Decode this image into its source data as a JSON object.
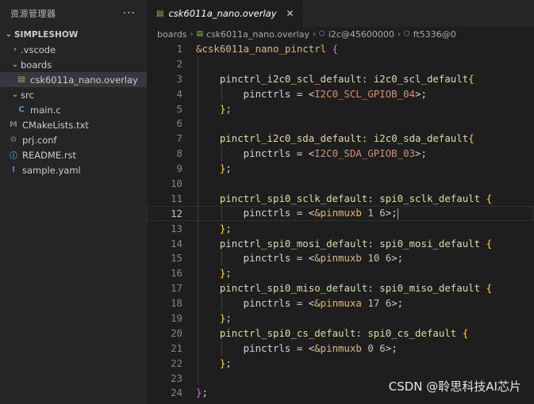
{
  "sidebar": {
    "header_label": "资源管理器",
    "more_label": "···",
    "project": "SIMPLESHOW",
    "items": [
      {
        "label": ".vscode",
        "type": "folder",
        "expanded": false
      },
      {
        "label": "boards",
        "type": "folder",
        "expanded": true
      },
      {
        "label": "csk6011a_nano.overlay",
        "type": "file",
        "icon": "devicetree-file-icon",
        "selected": true
      },
      {
        "label": "src",
        "type": "folder",
        "expanded": true
      },
      {
        "label": "main.c",
        "type": "file",
        "icon": "c-file-icon"
      },
      {
        "label": "CMakeLists.txt",
        "type": "file",
        "icon": "cmake-file-icon"
      },
      {
        "label": "prj.conf",
        "type": "file",
        "icon": "gear-file-icon"
      },
      {
        "label": "README.rst",
        "type": "file",
        "icon": "info-file-icon"
      },
      {
        "label": "sample.yaml",
        "type": "file",
        "icon": "yaml-file-icon"
      }
    ]
  },
  "editor": {
    "tab_label": "csk6011a_nano.overlay",
    "tab_close": "✕",
    "breadcrumb": [
      "boards",
      "csk6011a_nano.overlay",
      "i2c@45600000",
      "ft5336@0"
    ]
  },
  "code": {
    "current_line": 12,
    "line_numbers": [
      "1",
      "2",
      "3",
      "4",
      "5",
      "6",
      "7",
      "8",
      "9",
      "10",
      "11",
      "12",
      "13",
      "14",
      "15",
      "16",
      "17",
      "18",
      "19",
      "20",
      "21",
      "22",
      "23",
      "24"
    ],
    "lines": [
      [
        [
          "ref",
          "&csk6011a_nano_pinctrl"
        ],
        [
          "prop",
          " "
        ],
        [
          "br",
          "{"
        ]
      ],
      [],
      [
        [
          "prop",
          "    "
        ],
        [
          "lbl",
          "pinctrl_i2c0_scl_default"
        ],
        [
          "prop",
          ": "
        ],
        [
          "lbl",
          "i2c0_scl_default"
        ],
        [
          "br2",
          "{"
        ]
      ],
      [
        [
          "prop",
          "        pinctrls = <"
        ],
        [
          "str",
          "I2C0_SCL_GPIOB_04"
        ],
        [
          "prop",
          ">;"
        ]
      ],
      [
        [
          "prop",
          "    "
        ],
        [
          "br2",
          "}"
        ],
        [
          "prop",
          ";"
        ]
      ],
      [],
      [
        [
          "prop",
          "    "
        ],
        [
          "lbl",
          "pinctrl_i2c0_sda_default"
        ],
        [
          "prop",
          ": "
        ],
        [
          "lbl",
          "i2c0_sda_default"
        ],
        [
          "br2",
          "{"
        ]
      ],
      [
        [
          "prop",
          "        pinctrls = <"
        ],
        [
          "str",
          "I2C0_SDA_GPIOB_03"
        ],
        [
          "prop",
          ">;"
        ]
      ],
      [
        [
          "prop",
          "    "
        ],
        [
          "br2",
          "}"
        ],
        [
          "prop",
          ";"
        ]
      ],
      [],
      [
        [
          "prop",
          "    "
        ],
        [
          "lbl",
          "pinctrl_spi0_sclk_default"
        ],
        [
          "prop",
          ": "
        ],
        [
          "lbl",
          "spi0_sclk_default"
        ],
        [
          "prop",
          " "
        ],
        [
          "br2",
          "{"
        ]
      ],
      [
        [
          "prop",
          "        pinctrls = <"
        ],
        [
          "ref",
          "&pinmuxb"
        ],
        [
          "prop",
          " "
        ],
        [
          "num",
          "1 6"
        ],
        [
          "prop",
          ">;"
        ]
      ],
      [
        [
          "prop",
          "    "
        ],
        [
          "br2",
          "}"
        ],
        [
          "prop",
          ";"
        ]
      ],
      [
        [
          "prop",
          "    "
        ],
        [
          "lbl",
          "pinctrl_spi0_mosi_default"
        ],
        [
          "prop",
          ": "
        ],
        [
          "lbl",
          "spi0_mosi_default"
        ],
        [
          "prop",
          " "
        ],
        [
          "br2",
          "{"
        ]
      ],
      [
        [
          "prop",
          "        pinctrls = <"
        ],
        [
          "ref",
          "&pinmuxb"
        ],
        [
          "prop",
          " "
        ],
        [
          "num",
          "10 6"
        ],
        [
          "prop",
          ">;"
        ]
      ],
      [
        [
          "prop",
          "    "
        ],
        [
          "br2",
          "}"
        ],
        [
          "prop",
          ";"
        ]
      ],
      [
        [
          "prop",
          "    "
        ],
        [
          "lbl",
          "pinctrl_spi0_miso_default"
        ],
        [
          "prop",
          ": "
        ],
        [
          "lbl",
          "spi0_miso_default"
        ],
        [
          "prop",
          " "
        ],
        [
          "br2",
          "{"
        ]
      ],
      [
        [
          "prop",
          "        pinctrls = <"
        ],
        [
          "ref",
          "&pinmuxa"
        ],
        [
          "prop",
          " "
        ],
        [
          "num",
          "17 6"
        ],
        [
          "prop",
          ">;"
        ]
      ],
      [
        [
          "prop",
          "    "
        ],
        [
          "br2",
          "}"
        ],
        [
          "prop",
          ";"
        ]
      ],
      [
        [
          "prop",
          "    "
        ],
        [
          "lbl",
          "pinctrl_spi0_cs_default"
        ],
        [
          "prop",
          ": "
        ],
        [
          "lbl",
          "spi0_cs_default"
        ],
        [
          "prop",
          " "
        ],
        [
          "br2",
          "{"
        ]
      ],
      [
        [
          "prop",
          "        pinctrls = <"
        ],
        [
          "ref",
          "&pinmuxb"
        ],
        [
          "prop",
          " "
        ],
        [
          "num",
          "0 6"
        ],
        [
          "prop",
          ">;"
        ]
      ],
      [
        [
          "prop",
          "    "
        ],
        [
          "br2",
          "}"
        ],
        [
          "prop",
          ";"
        ]
      ],
      [],
      [
        [
          "br",
          "}"
        ],
        [
          "prop",
          ";"
        ]
      ]
    ]
  },
  "watermark": "CSDN @聆思科技AI芯片",
  "colors": {
    "background": "#1e1e1e",
    "sidebar": "#252526",
    "selected_row": "#37373d",
    "label": "#dcdcaa",
    "string": "#ce9178",
    "reference": "#d7ba7d",
    "bracket": "#da70d6"
  }
}
